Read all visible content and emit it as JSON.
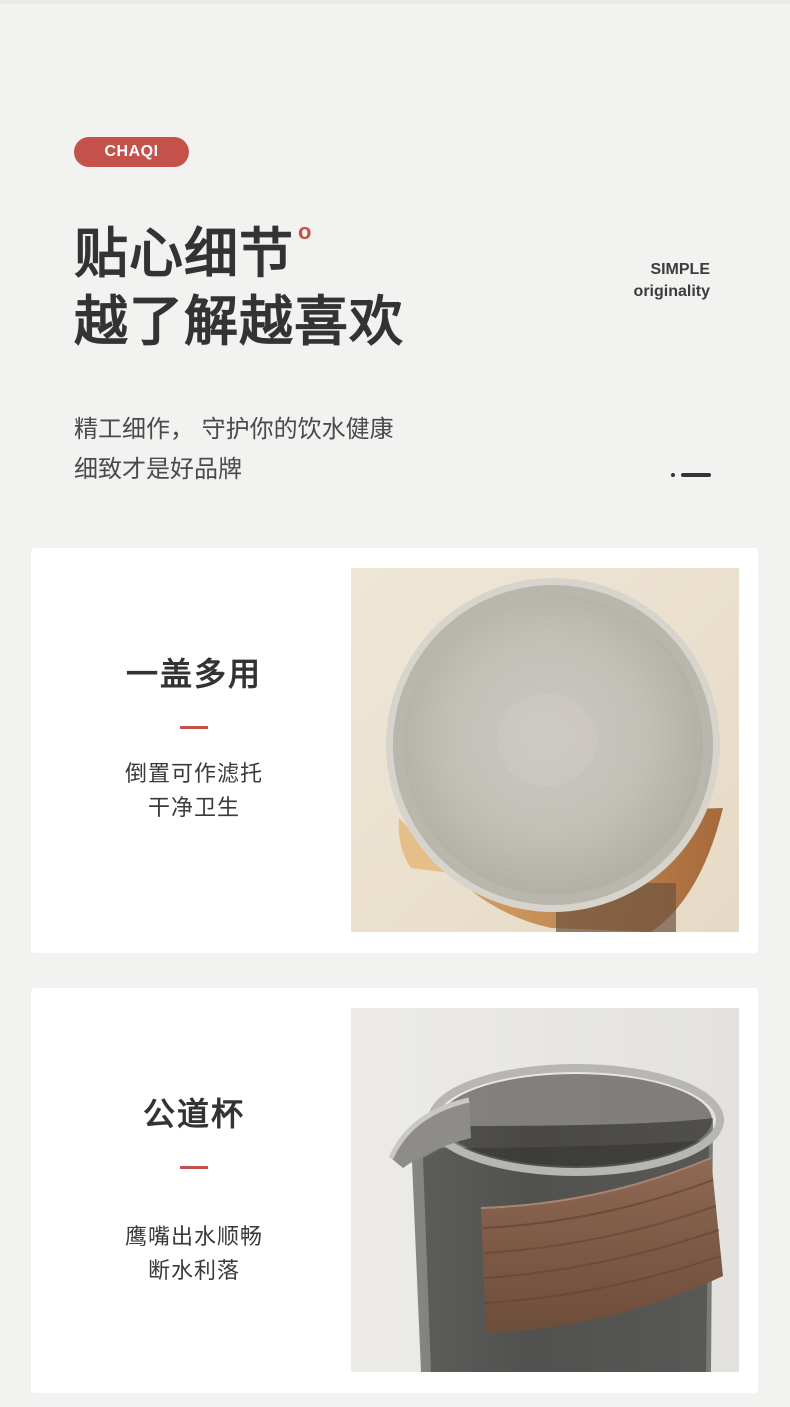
{
  "badge": "CHAQI",
  "title": {
    "line1": "贴心细节",
    "sup": "o",
    "line2": "越了解越喜欢"
  },
  "side_en": {
    "line1": "SIMPLE",
    "line2": "originality"
  },
  "desc": {
    "line1": "精工细作，  守护你的饮水健康",
    "line2": "细致才是好品牌"
  },
  "cards": [
    {
      "title": "一盖多用",
      "desc_line1": "倒置可作滤托",
      "desc_line2": "干净卫生",
      "photo": "lid-top-view-photo"
    },
    {
      "title": "公道杯",
      "desc_line1": "鹰嘴出水顺畅",
      "desc_line2": "断水利落",
      "photo": "glass-pitcher-photo"
    }
  ],
  "colors": {
    "accent": "#c4524b",
    "background": "#f2f2f1",
    "card": "#ffffff",
    "text": "#333333"
  }
}
